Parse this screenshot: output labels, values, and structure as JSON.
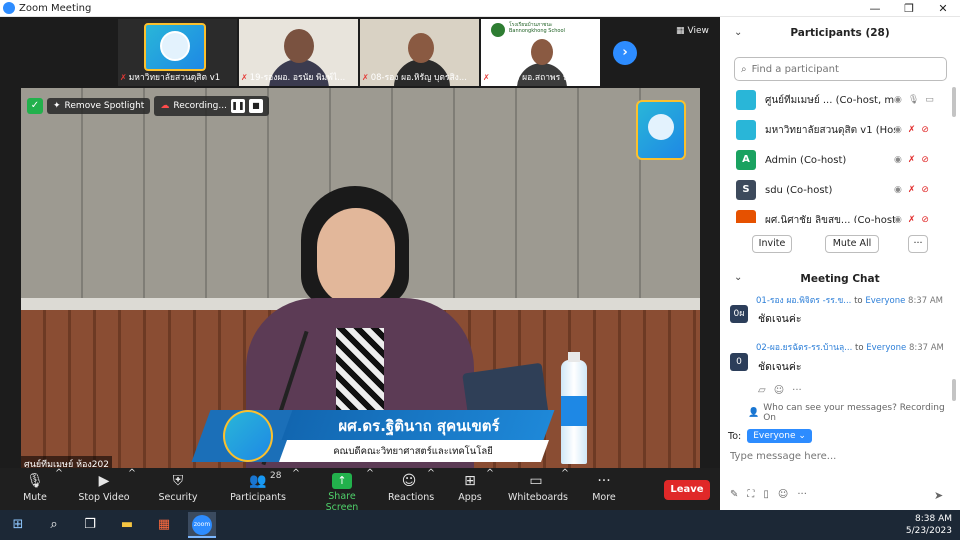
{
  "window": {
    "title": "Zoom Meeting",
    "minimize": "—",
    "maximize": "❐",
    "close": "✕"
  },
  "thumbnails": [
    {
      "label": "มหาวิทยาลัยสวนดุสิต v1"
    },
    {
      "label": "19-รองผอ. อรนัย พิมพ์ไ..."
    },
    {
      "label": "08-รอง ผอ.หิรัญ บุตรสิง..."
    },
    {
      "label": "21-รอง ผอ.สถาพร ปันตั..."
    }
  ],
  "thumb_school_text": "โรงเรียนบ้านภาชนะ Bannongkhong School",
  "view_label": "View",
  "spotlight": {
    "remove_label": "Remove Spotlight",
    "recording_label": "Recording..."
  },
  "lower_third": {
    "name": "ผศ.ดร.ฐิตินาถ สุคนเขตร์",
    "org": "คณบดีคณะวิทยาศาสตร์และเทคโนโลยี"
  },
  "main_name_tag": "ศูนย์ทีมเมษย์ ห้อง202",
  "toolbar": {
    "mute": "Mute",
    "stop_video": "Stop Video",
    "security": "Security",
    "participants": "Participants",
    "participants_count": "28",
    "share_screen": "Share Screen",
    "reactions": "Reactions",
    "apps": "Apps",
    "whiteboards": "Whiteboards",
    "more": "More",
    "leave": "Leave"
  },
  "participants_panel": {
    "title": "Participants (28)",
    "search_placeholder": "Find a participant",
    "items": [
      {
        "name": "ศูนย์ทีมเมษย์ ... (Co-host, me)",
        "avatar": "",
        "color": "#29b6d8"
      },
      {
        "name": "มหาวิทยาลัยสวนดุสิต v1 (Host)",
        "avatar": "",
        "color": "#29b6d8"
      },
      {
        "name": "Admin (Co-host)",
        "avatar": "A",
        "color": "#1aa260"
      },
      {
        "name": "sdu (Co-host)",
        "avatar": "S",
        "color": "#3d4a5c"
      },
      {
        "name": "ผศ.นิศาชัย ลิขสุข... (Co-host)",
        "avatar": "",
        "color": "#e65100"
      }
    ],
    "invite": "Invite",
    "mute_all": "Mute All",
    "more": "···"
  },
  "chat": {
    "title": "Meeting Chat",
    "messages": [
      {
        "from": "01-รอง ผอ.พิจิตร -รร.ข...",
        "to_word": "to",
        "to": "Everyone",
        "time": "8:37 AM",
        "avatar": "0ผ",
        "text": "ชัดเจนค่ะ"
      },
      {
        "from": "02-ผอ.ยรฉัตร-รร.บ้านลุ...",
        "to_word": "to",
        "to": "Everyone",
        "time": "8:37 AM",
        "avatar": "0",
        "text": "ชัดเจนค่ะ"
      }
    ],
    "who_can_see": "Who can see your messages? Recording On",
    "to_label": "To:",
    "to_value": "Everyone",
    "input_placeholder": "Type message here..."
  },
  "taskbar": {
    "time": "8:38 AM",
    "date": "5/23/2023",
    "zoom_text": "zoom"
  }
}
